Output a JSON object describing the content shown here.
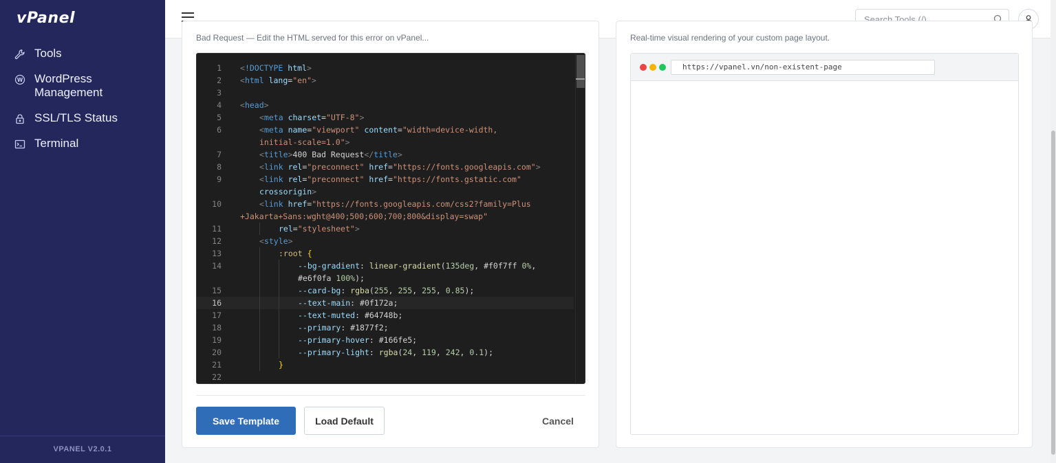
{
  "app": {
    "logo": "vPanel",
    "version": "VPANEL V2.0.1"
  },
  "sidebar": {
    "items": [
      {
        "label": "Tools",
        "icon": "wrench-icon"
      },
      {
        "label": "WordPress Management",
        "icon": "wordpress-icon"
      },
      {
        "label": "SSL/TLS Status",
        "icon": "lock-icon"
      },
      {
        "label": "Terminal",
        "icon": "terminal-icon"
      }
    ]
  },
  "header": {
    "search_placeholder": "Search Tools (/)"
  },
  "editor_card": {
    "subtitle": "Bad Request — Edit the HTML served for this error on vPanel...",
    "active_line": 16,
    "code_lines": [
      {
        "n": "1",
        "indent": 0,
        "html": "<span class='t-brk'>&lt;</span><span class='t-tag'>!DOCTYPE</span> <span class='t-attr'>html</span><span class='t-brk'>&gt;</span>"
      },
      {
        "n": "2",
        "indent": 0,
        "html": "<span class='t-brk'>&lt;</span><span class='t-tag'>html</span> <span class='t-attr'>lang</span>=<span class='t-str'>\"en\"</span><span class='t-brk'>&gt;</span>"
      },
      {
        "n": "3",
        "indent": 0,
        "html": ""
      },
      {
        "n": "4",
        "indent": 0,
        "html": "<span class='t-brk'>&lt;</span><span class='t-tag'>head</span><span class='t-brk'>&gt;</span>"
      },
      {
        "n": "5",
        "indent": 1,
        "html": "<span class='t-brk'>&lt;</span><span class='t-tag'>meta</span> <span class='t-attr'>charset</span>=<span class='t-str'>\"UTF-8\"</span><span class='t-brk'>&gt;</span>"
      },
      {
        "n": "6",
        "indent": 1,
        "html": "<span class='t-brk'>&lt;</span><span class='t-tag'>meta</span> <span class='t-attr'>name</span>=<span class='t-str'>\"viewport\"</span> <span class='t-attr'>content</span>=<span class='t-str'>\"width=device-width,</span>"
      },
      {
        "n": "",
        "indent": 1,
        "html": "<span class='t-str'>initial-scale=1.0\"</span><span class='t-brk'>&gt;</span>"
      },
      {
        "n": "7",
        "indent": 1,
        "html": "<span class='t-brk'>&lt;</span><span class='t-tag'>title</span><span class='t-brk'>&gt;</span><span class='t-txt'>400 Bad Request</span><span class='t-brk'>&lt;/</span><span class='t-tag'>title</span><span class='t-brk'>&gt;</span>"
      },
      {
        "n": "8",
        "indent": 1,
        "html": "<span class='t-brk'>&lt;</span><span class='t-tag'>link</span> <span class='t-attr'>rel</span>=<span class='t-str'>\"preconnect\"</span> <span class='t-attr'>href</span>=<span class='t-str'>\"https://fonts.googleapis.com\"</span><span class='t-brk'>&gt;</span>"
      },
      {
        "n": "9",
        "indent": 1,
        "html": "<span class='t-brk'>&lt;</span><span class='t-tag'>link</span> <span class='t-attr'>rel</span>=<span class='t-str'>\"preconnect\"</span> <span class='t-attr'>href</span>=<span class='t-str'>\"https://fonts.gstatic.com\"</span>"
      },
      {
        "n": "",
        "indent": 1,
        "html": "<span class='t-attr'>crossorigin</span><span class='t-brk'>&gt;</span>"
      },
      {
        "n": "10",
        "indent": 1,
        "html": "<span class='t-brk'>&lt;</span><span class='t-tag'>link</span> <span class='t-attr'>href</span>=<span class='t-str'>\"https://fonts.googleapis.com/css2?family=Plus</span>"
      },
      {
        "n": "",
        "indent": 0,
        "html": "<span class='t-str'>+Jakarta+Sans:wght@400;500;600;700;800&amp;display=swap\"</span>"
      },
      {
        "n": "11",
        "indent": 2,
        "html": "<span class='t-attr'>rel</span>=<span class='t-str'>\"stylesheet\"</span><span class='t-brk'>&gt;</span>"
      },
      {
        "n": "12",
        "indent": 1,
        "html": "<span class='t-brk'>&lt;</span><span class='t-tag'>style</span><span class='t-brk'>&gt;</span>"
      },
      {
        "n": "13",
        "indent": 2,
        "html": "<span class='t-sel'>:root</span> <span class='t-brace'>{</span>"
      },
      {
        "n": "14",
        "indent": 3,
        "html": "<span class='t-prop'>--bg-gradient</span>: <span class='t-fn'>linear-gradient</span>(<span class='t-num'>135deg</span>, #f0f7ff <span class='t-num'>0%</span>,"
      },
      {
        "n": "",
        "indent": 3,
        "html": "#e6f0fa <span class='t-num'>100%</span>);"
      },
      {
        "n": "15",
        "indent": 3,
        "html": "<span class='t-prop'>--card-bg</span>: <span class='t-fn'>rgba</span>(<span class='t-num'>255</span>, <span class='t-num'>255</span>, <span class='t-num'>255</span>, <span class='t-num'>0.85</span>);"
      },
      {
        "n": "16",
        "indent": 3,
        "html": "<span class='t-prop'>--text-main</span>: #0f172a;"
      },
      {
        "n": "17",
        "indent": 3,
        "html": "<span class='t-prop'>--text-muted</span>: #64748b;"
      },
      {
        "n": "18",
        "indent": 3,
        "html": "<span class='t-prop'>--primary</span>: #1877f2;"
      },
      {
        "n": "19",
        "indent": 3,
        "html": "<span class='t-prop'>--primary-hover</span>: #166fe5;"
      },
      {
        "n": "20",
        "indent": 3,
        "html": "<span class='t-prop'>--primary-light</span>: <span class='t-fn'>rgba</span>(<span class='t-num'>24</span>, <span class='t-num'>119</span>, <span class='t-num'>242</span>, <span class='t-num'>0.1</span>);"
      },
      {
        "n": "21",
        "indent": 2,
        "html": "<span class='t-brace'>}</span>"
      },
      {
        "n": "22",
        "indent": 0,
        "html": ""
      }
    ],
    "buttons": {
      "save": "Save Template",
      "load": "Load Default",
      "cancel": "Cancel"
    }
  },
  "preview_card": {
    "subtitle": "Real-time visual rendering of your custom page layout.",
    "url": "https://vpanel.vn/non-existent-page",
    "dot_colors": [
      "#ef4444",
      "#f5b400",
      "#22c55e"
    ]
  },
  "colors": {
    "sidebar_bg": "#23275c",
    "primary": "#2f6db8"
  }
}
